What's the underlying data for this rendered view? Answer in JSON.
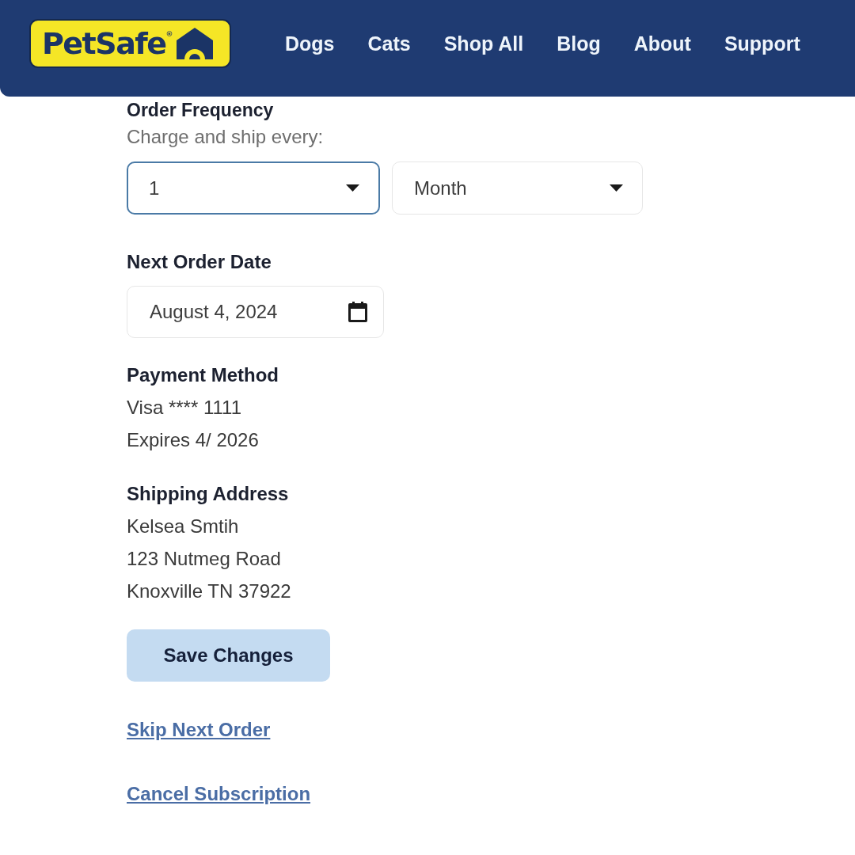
{
  "header": {
    "logo": {
      "text": "PetSafe$^{®}$"
    },
    "nav": [
      "Dogs",
      "Cats",
      "Shop All",
      "Blog",
      "About",
      "Support"
    ]
  },
  "order_frequency": {
    "heading": "Order Frequency",
    "label": "Charge and ship every:",
    "selects": [
      {
        "value": "1",
        "focused": true
      },
      {
        "value": "Month",
        "focused": false
      }
    ]
  },
  "next_order_date": {
    "heading": "Next Order Date",
    "value": "August 4, 2024"
  },
  "payment_method": {
    "heading": "Payment Method",
    "lines": [
      "Visa **** 1111",
      "Expires 4/ 2026"
    ]
  },
  "shipping_address": {
    "heading": "Shipping Address",
    "lines": [
      "Kelsea Smtih",
      "123 Nutmeg Road",
      "Knoxville TN 37922"
    ]
  },
  "save_button": {
    "label": "Save Changes"
  },
  "links": [
    "Skip Next Order",
    "Cancel Subscription"
  ]
}
